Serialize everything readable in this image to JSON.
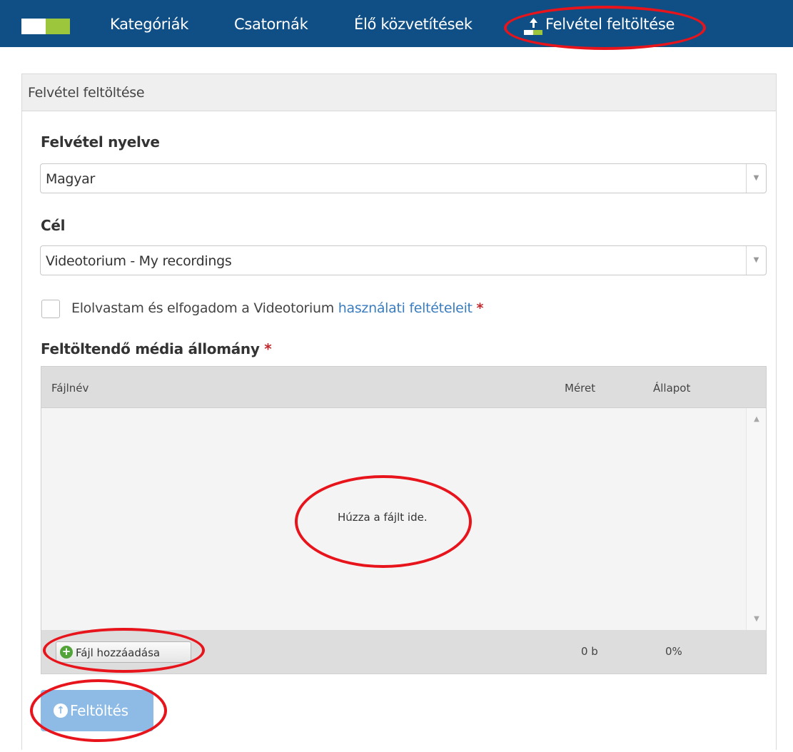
{
  "nav": {
    "items": [
      "Kategóriák",
      "Csatornák",
      "Élő közvetítések",
      "Felvétel feltöltése"
    ]
  },
  "panel": {
    "title": "Felvétel feltöltése"
  },
  "form": {
    "language_label": "Felvétel nyelve",
    "language_value": "Magyar",
    "target_label": "Cél",
    "target_value": "Videotorium - My recordings",
    "terms_text": "Elolvastam és elfogadom a Videotorium ",
    "terms_link": "használati feltételeit",
    "required_mark": "*",
    "media_label": "Feltöltendő média állomány"
  },
  "uploader": {
    "columns": [
      "Fájlnév",
      "Méret",
      "Állapot"
    ],
    "drop_text": "Húzza a fájlt ide.",
    "add_button": "Fájl hozzáadása",
    "total_size": "0 b",
    "total_progress": "0%"
  },
  "submit_label": "Feltöltés",
  "colors": {
    "topbar": "#0f4f85",
    "logo_green": "#9cc63b",
    "link": "#3b7dbf",
    "required": "#c0262c",
    "submit": "#8dbbe6",
    "annotation": "#e8141c"
  },
  "icons": [
    "upload-icon",
    "plus-icon",
    "arrow-up-circle-icon",
    "chevron-down-icon"
  ]
}
